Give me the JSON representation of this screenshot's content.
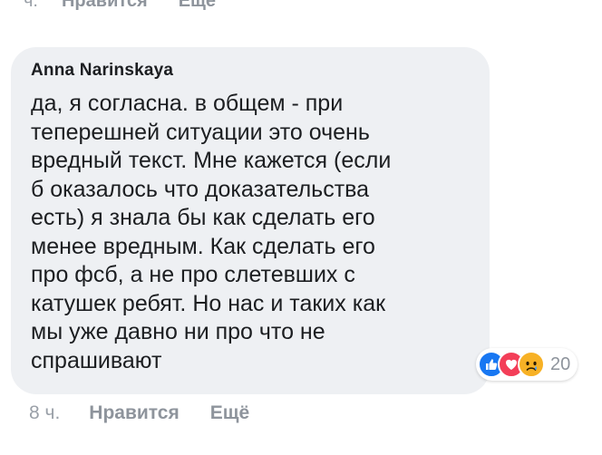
{
  "prev_comment": {
    "time": "ч.",
    "like_label": "Нравится",
    "more_label": "Ещё"
  },
  "comment": {
    "author": "Anna Narinskaya",
    "text": "да, я согласна. в общем - при\nтеперешней ситуации это очень\nвредный текст. Мне кажется (если\nб оказалось что доказательства\nесть) я знала бы как сделать его\nменее вредным. Как сделать его\nпро фсб, а не про слетевших с\nкатушек ребят. Но нас и таких как\nмы уже давно ни про что не\nспрашивают",
    "reactions": {
      "icons": [
        "like-icon",
        "love-icon",
        "sad-icon"
      ],
      "count": "20"
    },
    "time": "8 ч.",
    "like_label": "Нравится",
    "more_label": "Ещё"
  },
  "colors": {
    "bubble": "#eef0f3",
    "like": "#1877f2",
    "love": "#f33e58",
    "sad": "#f7b125",
    "muted": "#8e949c"
  }
}
